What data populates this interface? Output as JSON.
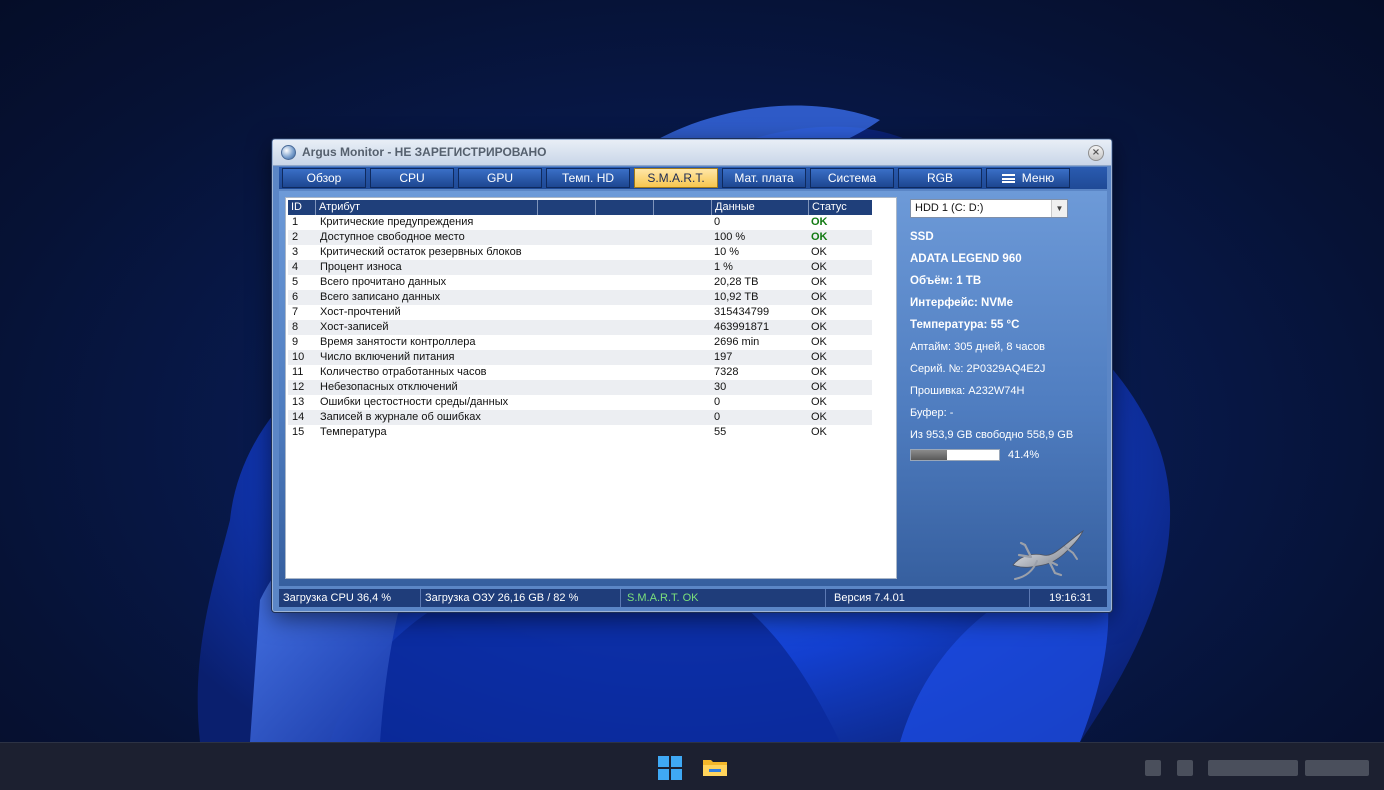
{
  "window": {
    "title": "Argus Monitor - НЕ ЗАРЕГИСТРИРОВАНО",
    "close_symbol": "×"
  },
  "tabs": [
    {
      "label": "Обзор"
    },
    {
      "label": "CPU"
    },
    {
      "label": "GPU"
    },
    {
      "label": "Темп. HD"
    },
    {
      "label": "S.M.A.R.T.",
      "active": true
    },
    {
      "label": "Мат. плата"
    },
    {
      "label": "Система"
    },
    {
      "label": "RGB"
    },
    {
      "label": "Меню"
    }
  ],
  "smart_table": {
    "headers": {
      "id": "ID",
      "attribute": "Атрибут",
      "data": "Данные",
      "status": "Статус"
    },
    "rows": [
      {
        "id": "1",
        "attribute": "Критические предупреждения",
        "data": "0",
        "status": "OK",
        "status_bold": true
      },
      {
        "id": "2",
        "attribute": "Доступное свободное место",
        "data": "100 %",
        "status": "OK",
        "status_bold": true
      },
      {
        "id": "3",
        "attribute": "Критический остаток резервных блоков",
        "data": "10 %",
        "status": "OK"
      },
      {
        "id": "4",
        "attribute": "Процент износа",
        "data": "1 %",
        "status": "OK"
      },
      {
        "id": "5",
        "attribute": "Всего прочитано данных",
        "data": "20,28 TB",
        "status": "OK"
      },
      {
        "id": "6",
        "attribute": "Всего записано данных",
        "data": "10,92 TB",
        "status": "OK"
      },
      {
        "id": "7",
        "attribute": "Хост-прочтений",
        "data": "315434799",
        "status": "OK"
      },
      {
        "id": "8",
        "attribute": "Хост-записей",
        "data": "463991871",
        "status": "OK"
      },
      {
        "id": "9",
        "attribute": "Время занятости контроллера",
        "data": "2696 min",
        "status": "OK"
      },
      {
        "id": "10",
        "attribute": "Число включений питания",
        "data": "197",
        "status": "OK"
      },
      {
        "id": "11",
        "attribute": "Количество отработанных часов",
        "data": "7328",
        "status": "OK"
      },
      {
        "id": "12",
        "attribute": "Небезопасных отключений",
        "data": "30",
        "status": "OK"
      },
      {
        "id": "13",
        "attribute": "Ошибки цестостности среды/данных",
        "data": "0",
        "status": "OK"
      },
      {
        "id": "14",
        "attribute": "Записей в журнале об ошибках",
        "data": "0",
        "status": "OK"
      },
      {
        "id": "15",
        "attribute": "Температура",
        "data": "55",
        "status": "OK"
      }
    ]
  },
  "info": {
    "drive_select": "HDD 1 (C: D:)",
    "type": "SSD",
    "model": "ADATA LEGEND 960",
    "capacity": "Объём: 1 TB",
    "interface": "Интерфейс: NVMe",
    "temperature": "Температура: 55 °C",
    "uptime": "Аптайм: 305 дней, 8 часов",
    "serial": "Серий. №: 2P0329AQ4E2J",
    "firmware": "Прошивка: A232W74H",
    "buffer": "Буфер: -",
    "free_space": "Из 953,9 GB свободно 558,9 GB",
    "usage_percent_label": "41.4%",
    "usage_fraction": 0.414
  },
  "statusbar": {
    "cpu": "Загрузка CPU 36,4 %",
    "ram": "Загрузка ОЗУ 26,16 GB / 82 %",
    "smart": "S.M.A.R.T. OK",
    "version": "Версия 7.4.01",
    "time": "19:16:31"
  },
  "colors": {
    "accent_tab": "#f7c64f",
    "ok_green": "#137a13",
    "status_green": "#7be07b"
  }
}
